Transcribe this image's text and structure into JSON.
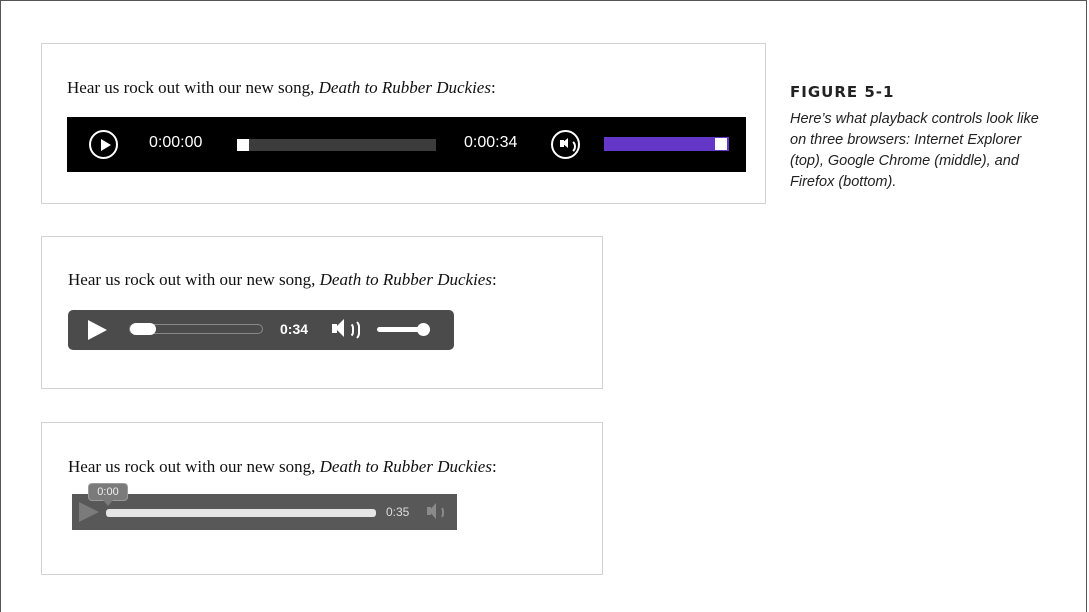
{
  "sentence": {
    "prefix": "Hear us rock out with our new song, ",
    "song_title": "Death to Rubber Duckies",
    "suffix": ":"
  },
  "ie_player": {
    "current_time": "0:00:00",
    "duration": "0:00:34",
    "progress_fraction": 0.0,
    "volume_fraction": 1.0,
    "volume_color": "#6437c8"
  },
  "chrome_player": {
    "time": "0:34",
    "progress_fraction": 0.0,
    "volume_fraction": 1.0
  },
  "firefox_player": {
    "tooltip_time": "0:00",
    "duration": "0:35",
    "progress_fraction": 0.0
  },
  "figure": {
    "label": "FIGURE 5-1",
    "caption": "Here’s what playback controls look like on three browsers: Internet Explorer (top), Google Chrome (middle), and Firefox (bottom)."
  }
}
